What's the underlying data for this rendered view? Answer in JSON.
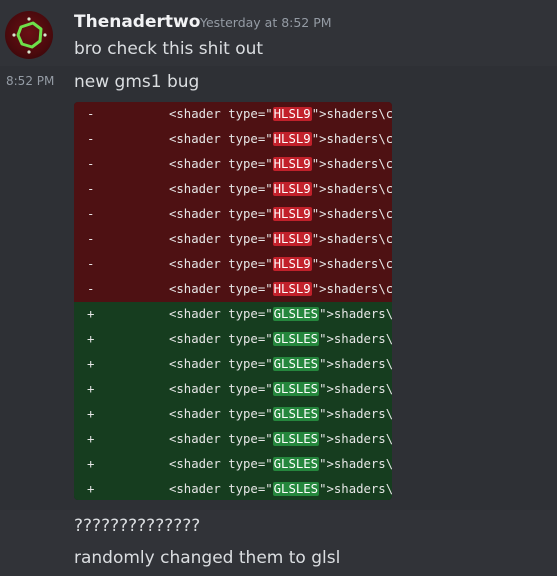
{
  "message": {
    "username": "Thenadertwo",
    "timestamp": "Yesterday at 8:52 PM",
    "side_time": "8:52 PM",
    "lines": [
      "bro check this shit out",
      "new gms1 bug",
      "??????????????",
      "randomly changed them to glsl"
    ]
  },
  "diff": {
    "removed_lines": [
      {
        "sign": "-",
        "prefix": "<shader type=\"",
        "highlight": "HLSL9",
        "suffix": "\">shaders\\c"
      },
      {
        "sign": "-",
        "prefix": "<shader type=\"",
        "highlight": "HLSL9",
        "suffix": "\">shaders\\c"
      },
      {
        "sign": "-",
        "prefix": "<shader type=\"",
        "highlight": "HLSL9",
        "suffix": "\">shaders\\c"
      },
      {
        "sign": "-",
        "prefix": "<shader type=\"",
        "highlight": "HLSL9",
        "suffix": "\">shaders\\c"
      },
      {
        "sign": "-",
        "prefix": "<shader type=\"",
        "highlight": "HLSL9",
        "suffix": "\">shaders\\c"
      },
      {
        "sign": "-",
        "prefix": "<shader type=\"",
        "highlight": "HLSL9",
        "suffix": "\">shaders\\c"
      },
      {
        "sign": "-",
        "prefix": "<shader type=\"",
        "highlight": "HLSL9",
        "suffix": "\">shaders\\c"
      },
      {
        "sign": "-",
        "prefix": "<shader type=\"",
        "highlight": "HLSL9",
        "suffix": "\">shaders\\c"
      }
    ],
    "added_lines": [
      {
        "sign": "+",
        "prefix": "<shader type=\"",
        "highlight": "GLSLES",
        "suffix": "\">shaders\\"
      },
      {
        "sign": "+",
        "prefix": "<shader type=\"",
        "highlight": "GLSLES",
        "suffix": "\">shaders\\"
      },
      {
        "sign": "+",
        "prefix": "<shader type=\"",
        "highlight": "GLSLES",
        "suffix": "\">shaders\\"
      },
      {
        "sign": "+",
        "prefix": "<shader type=\"",
        "highlight": "GLSLES",
        "suffix": "\">shaders\\"
      },
      {
        "sign": "+",
        "prefix": "<shader type=\"",
        "highlight": "GLSLES",
        "suffix": "\">shaders\\"
      },
      {
        "sign": "+",
        "prefix": "<shader type=\"",
        "highlight": "GLSLES",
        "suffix": "\">shaders\\"
      },
      {
        "sign": "+",
        "prefix": "<shader type=\"",
        "highlight": "GLSLES",
        "suffix": "\">shaders\\"
      },
      {
        "sign": "+",
        "prefix": "<shader type=\"",
        "highlight": "GLSLES",
        "suffix": "\">shaders\\"
      }
    ]
  },
  "colors": {
    "background": "#313338",
    "removed_bg": "#4e1113",
    "added_bg": "#163d1f",
    "removed_highlight": "#c2212b",
    "added_highlight": "#25873d"
  },
  "icons": {
    "avatar": "avatar-image"
  }
}
